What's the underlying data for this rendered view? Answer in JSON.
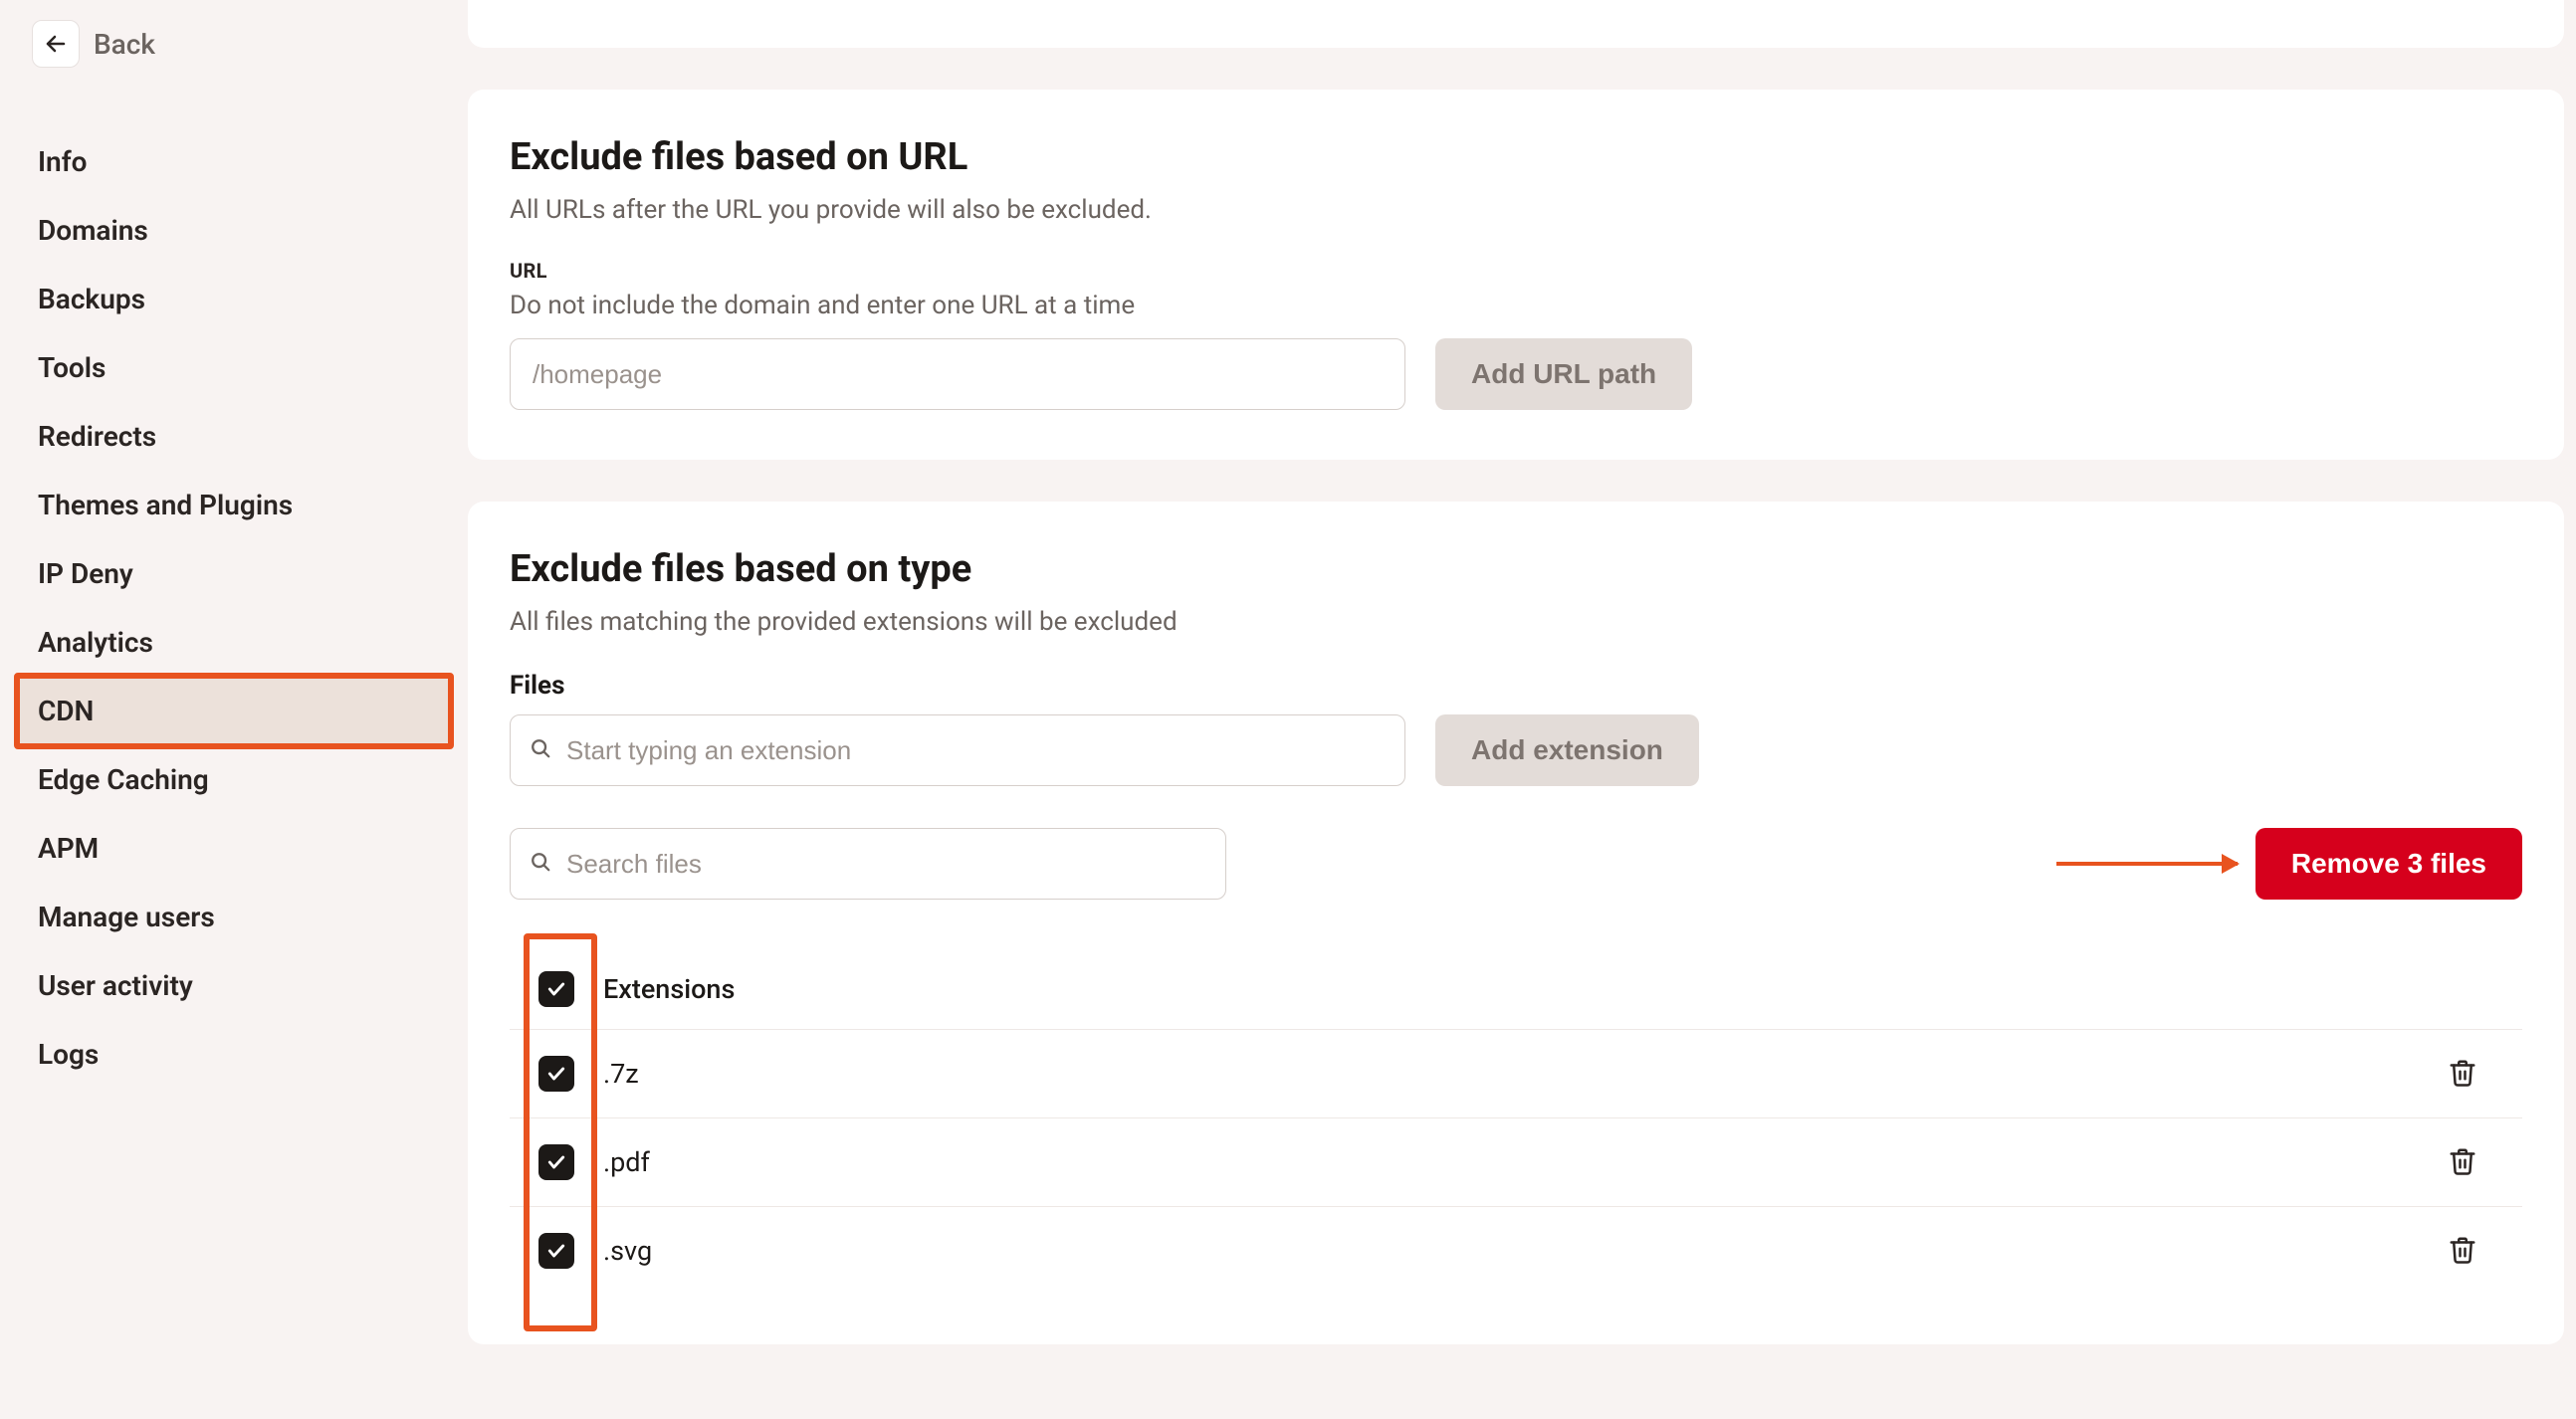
{
  "back": {
    "label": "Back"
  },
  "nav": {
    "items": [
      {
        "label": "Info",
        "active": false
      },
      {
        "label": "Domains",
        "active": false
      },
      {
        "label": "Backups",
        "active": false
      },
      {
        "label": "Tools",
        "active": false
      },
      {
        "label": "Redirects",
        "active": false
      },
      {
        "label": "Themes and Plugins",
        "active": false
      },
      {
        "label": "IP Deny",
        "active": false
      },
      {
        "label": "Analytics",
        "active": false
      },
      {
        "label": "CDN",
        "active": true
      },
      {
        "label": "Edge Caching",
        "active": false
      },
      {
        "label": "APM",
        "active": false
      },
      {
        "label": "Manage users",
        "active": false
      },
      {
        "label": "User activity",
        "active": false
      },
      {
        "label": "Logs",
        "active": false
      }
    ]
  },
  "urlExclude": {
    "title": "Exclude files based on URL",
    "desc": "All URLs after the URL you provide will also be excluded.",
    "fieldLabel": "URL",
    "fieldHelp": "Do not include the domain and enter one URL at a time",
    "placeholder": "/homepage",
    "addBtn": "Add URL path"
  },
  "typeExclude": {
    "title": "Exclude files based on type",
    "desc": "All files matching the provided extensions will be excluded",
    "filesLabel": "Files",
    "extPlaceholder": "Start typing an extension",
    "addExtBtn": "Add extension",
    "searchPlaceholder": "Search files",
    "removeBtn": "Remove 3 files",
    "headerLabel": "Extensions",
    "rows": [
      {
        "ext": ".7z",
        "checked": true
      },
      {
        "ext": ".pdf",
        "checked": true
      },
      {
        "ext": ".svg",
        "checked": true
      }
    ]
  }
}
